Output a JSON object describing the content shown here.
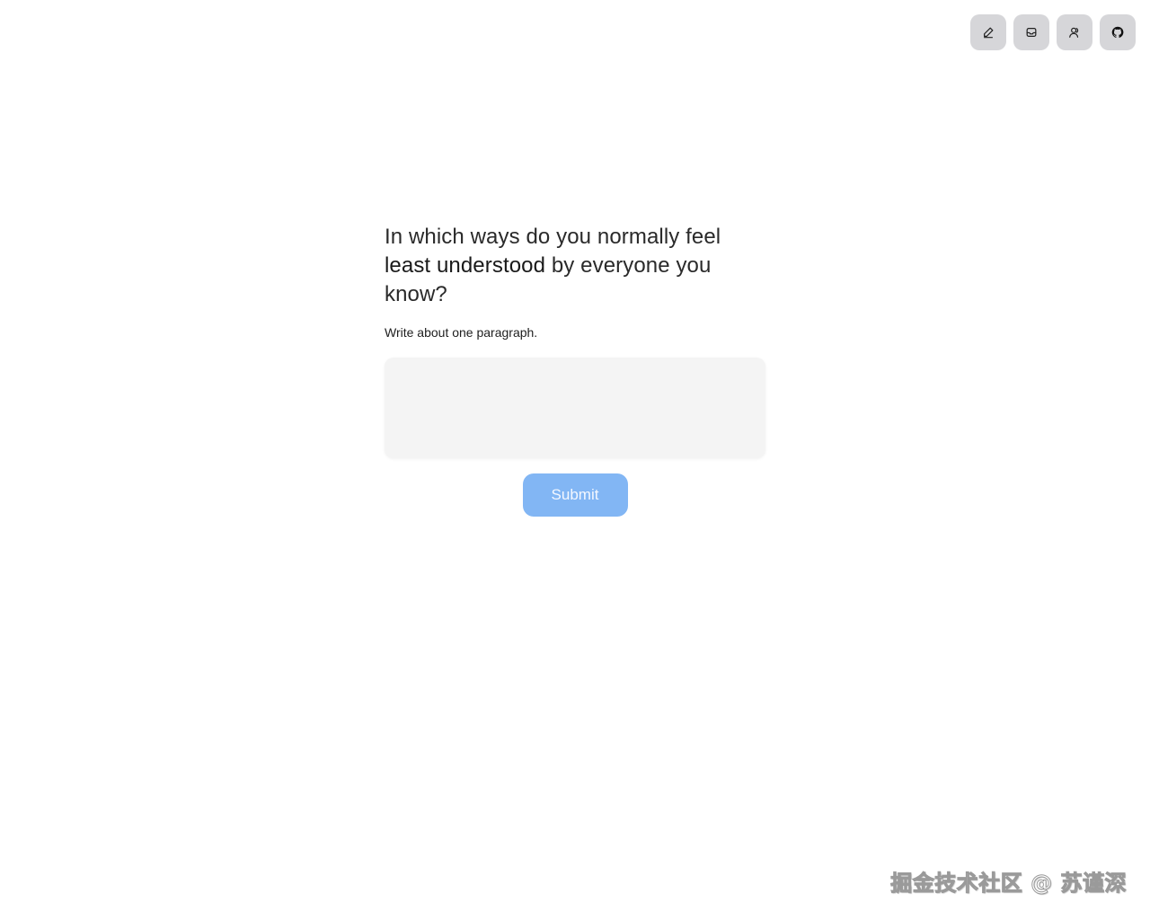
{
  "toolbar": {
    "buttons": [
      {
        "icon": "pencil-icon"
      },
      {
        "icon": "inbox-icon"
      },
      {
        "icon": "users-icon"
      },
      {
        "icon": "github-icon"
      }
    ]
  },
  "question": {
    "part1": "In which ways do you normally feel ",
    "emphasis": "least understood",
    "part2": " by everyone you know?"
  },
  "hint": "Write about one paragraph.",
  "answer": {
    "value": "",
    "placeholder": ""
  },
  "submit_label": "Submit",
  "watermark": "掘金技术社区 @ 苏谨深",
  "colors": {
    "toolbar_button_bg": "#d6d6d9",
    "submit_bg": "#82b6f4",
    "answer_bg": "#f4f4f4"
  }
}
